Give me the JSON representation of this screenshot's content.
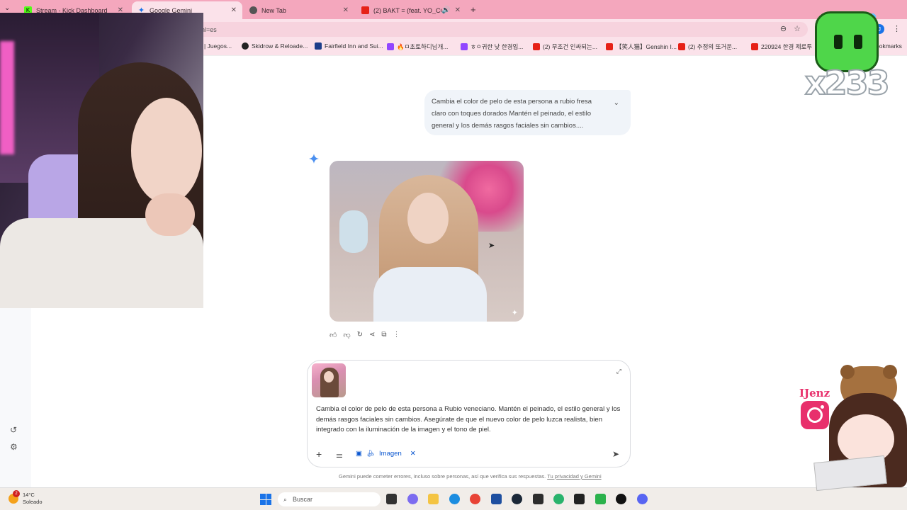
{
  "browser": {
    "tabs": [
      {
        "label": "Stream - Kick Dashboard",
        "icon": "kick-icon",
        "active": false
      },
      {
        "label": "Google Gemini",
        "icon": "gemini-icon",
        "active": true
      },
      {
        "label": "New Tab",
        "icon": "chrome-icon",
        "active": false
      },
      {
        "label": "(2) BAKT = (feat. YO_CO)(C",
        "icon": "youtube-icon",
        "active": false
      }
    ],
    "url": "hl=es",
    "bookmarks": [
      "| Juegos...",
      "Skidrow & Reloade...",
      "Fairfield Inn and Sui...",
      "🔥ㅁ초토하디님개...",
      "ㅎㅇ귀한 낮 한경입...",
      "(2) 무조건 인싸되는...",
      "【笑人猫】Genshin I...",
      "(2) 추정의 또거운...",
      "220924 한경 제로투",
      "ookmarks"
    ],
    "profile_initial": "J"
  },
  "chat": {
    "user_message": "Cambia el color de pelo de esta persona a rubio fresa claro con toques dorados Mantén el peinado, el estilo general y los demás rasgos faciales sin cambios...."
  },
  "composer": {
    "prompt": "Cambia el color de pelo de esta persona a Rubio veneciano. Mantén el peinado, el estilo general y los demás rasgos faciales sin cambios. Asegúrate de que el nuevo color de pelo luzca realista, bien integrado con la iluminación de la imagen y el tono de piel.",
    "chip_label": "Imagen"
  },
  "disclaimer": {
    "text": "Gemini puede cometer errores, incluso sobre personas, así que verifica sus respuestas.",
    "link": "Tu privacidad y Gemini"
  },
  "taskbar": {
    "temperature": "14°C",
    "condition": "Soleado",
    "weather_badge": "2",
    "search_placeholder": "Buscar"
  },
  "overlays": {
    "combo_count": "x233",
    "instagram_handle": "IJenz"
  },
  "colors": {
    "tabstrip": "#f4a7bd",
    "accent": "#0b57d0",
    "instagram": "#e8306c"
  }
}
